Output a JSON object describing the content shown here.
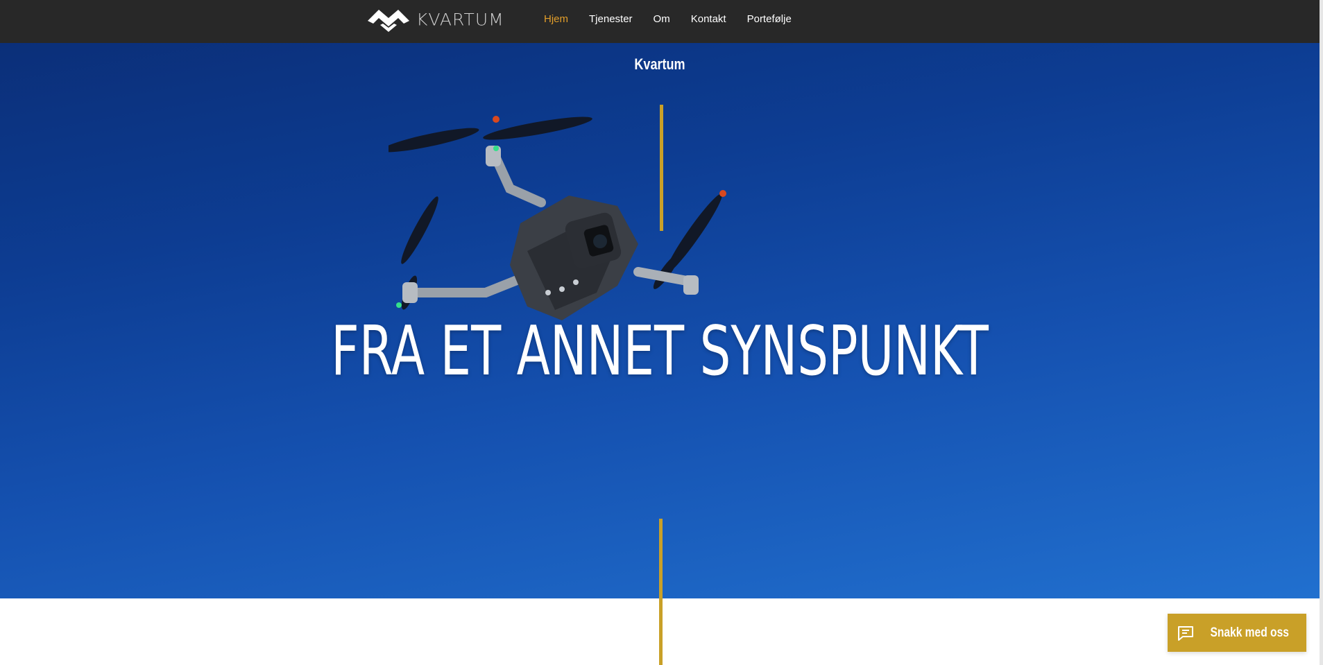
{
  "header": {
    "logo_text": "KVARTUM",
    "nav": [
      {
        "label": "Hjem",
        "active": true
      },
      {
        "label": "Tjenester",
        "active": false
      },
      {
        "label": "Om",
        "active": false
      },
      {
        "label": "Kontakt",
        "active": false
      },
      {
        "label": "Portefølje",
        "active": false
      }
    ]
  },
  "hero": {
    "brand": "Kvartum",
    "headline": "FRA ET ANNET SYNSPUNKT"
  },
  "chat": {
    "label": "Snakk med oss",
    "icon": "chat-bubble-icon"
  },
  "colors": {
    "header_bg": "#282828",
    "accent_gold": "#c9a028",
    "nav_active": "#e29e2a",
    "sky_blue": "#1551b0"
  }
}
